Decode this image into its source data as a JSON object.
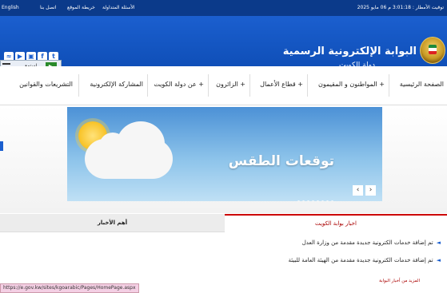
{
  "topbar": {
    "date_text": "توقيت الأمطار : 3:01:18 م 06 مايو 2025",
    "links": [
      "English",
      "اتصل بنا",
      "خريطة الموقع",
      "الأسئلة المتداولة"
    ]
  },
  "header": {
    "title": "البوابة الإلكترونية الرسمية",
    "subtitle": "دولة الكويت",
    "social": [
      "twitter-icon",
      "facebook-icon",
      "instagram-icon",
      "youtube-icon",
      "rss-icon"
    ],
    "player_label": "استمع"
  },
  "nav": {
    "items": [
      "الصفحة الرئيسية",
      "المواطنون و المقيمون +",
      "قطاع الأعمال +",
      "الزائرون +",
      "عن دولة الكويت +",
      "المشاركة الإلكترونية",
      "التشريعات والقوانين"
    ]
  },
  "hero": {
    "caption": "توقعات الطقس",
    "slide_count": 8,
    "prev_label": "‹",
    "next_label": "›"
  },
  "tabs": {
    "active": "اخبار بوابة الكويت",
    "inactive": "أهم الأخبار"
  },
  "news": [
    "تم إضافة خدمات الكترونية جديدة مقدمة من وزارة العدل",
    "تم إضافة خدمات الكترونية جديدة مقدمة من الهيئة العامة للبيئة"
  ],
  "more_link": "المزيد من أخبار البوابة",
  "status_url": "https://e.gov.kw/sites/kgoarabic/Pages/HomePage.aspx"
}
